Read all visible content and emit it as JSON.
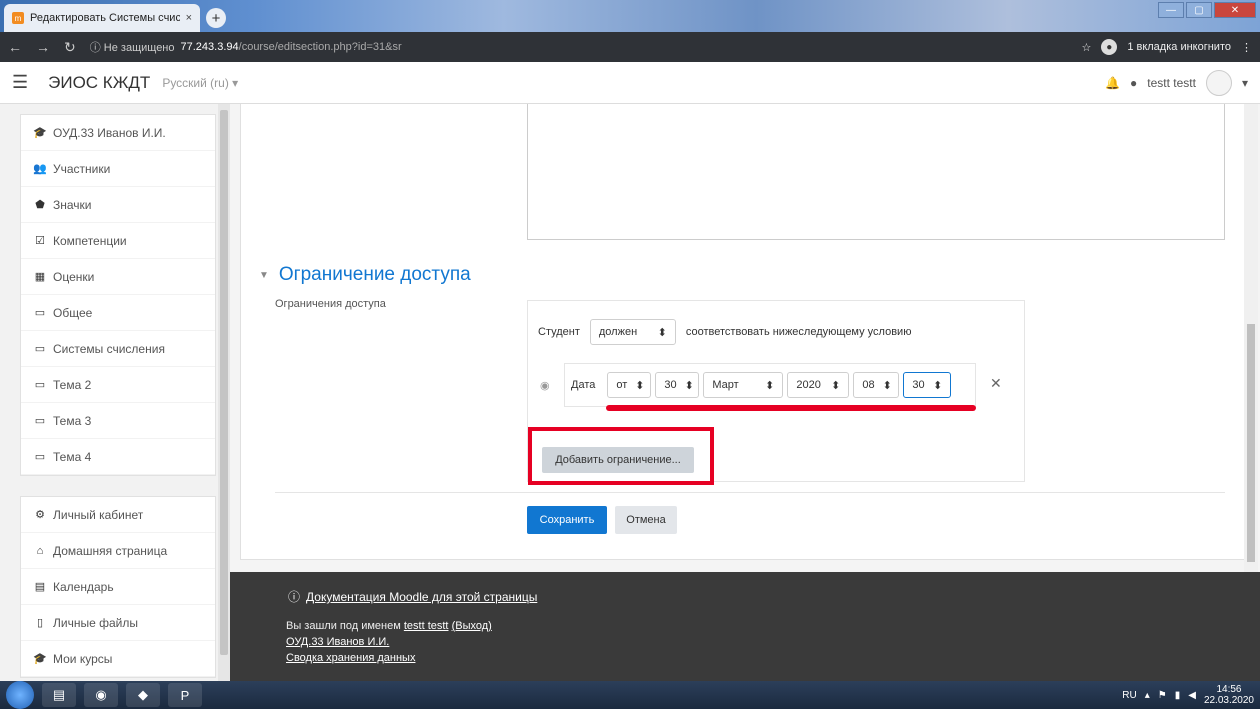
{
  "browser": {
    "tab_title": "Редактировать Системы счисле",
    "tab_close": "×",
    "new_tab": "+",
    "address_security": "ⓘ Не защищено",
    "address_host": "77.243.3.94",
    "address_path": "/course/editsection.php?id=31&sr",
    "incognito_label": "1 вкладка инкогнито",
    "win_min": "—",
    "win_max": "▢",
    "win_close": "✕"
  },
  "navbar": {
    "brand": "ЭИОС КЖДТ",
    "language": "Русский (ru) ▾",
    "user_name": "testt testt"
  },
  "sidebar": {
    "course_items": [
      {
        "label": "ОУД.33 Иванов И.И.",
        "icon": "graduation-cap-icon"
      },
      {
        "label": "Участники",
        "icon": "users-icon"
      },
      {
        "label": "Значки",
        "icon": "shield-icon"
      },
      {
        "label": "Компетенции",
        "icon": "check-square-icon"
      },
      {
        "label": "Оценки",
        "icon": "table-icon"
      },
      {
        "label": "Общее",
        "icon": "folder-icon"
      },
      {
        "label": "Системы счисления",
        "icon": "folder-icon"
      },
      {
        "label": "Тема 2",
        "icon": "folder-icon"
      },
      {
        "label": "Тема 3",
        "icon": "folder-icon"
      },
      {
        "label": "Тема 4",
        "icon": "folder-icon"
      }
    ],
    "site_items": [
      {
        "label": "Личный кабинет",
        "icon": "dashboard-icon"
      },
      {
        "label": "Домашняя страница",
        "icon": "home-icon"
      },
      {
        "label": "Календарь",
        "icon": "calendar-icon"
      },
      {
        "label": "Личные файлы",
        "icon": "file-icon"
      },
      {
        "label": "Мои курсы",
        "icon": "graduation-cap-icon"
      }
    ]
  },
  "form": {
    "section_title": "Ограничение доступа",
    "restrictions_label": "Ограничения доступа",
    "student_label": "Студент",
    "must_select": "должен",
    "match_text": "соответствовать нижеследующему условию",
    "date_label": "Дата",
    "date_from": "от",
    "date_day": "30",
    "date_month": "Март",
    "date_year": "2020",
    "date_hour": "08",
    "date_minute": "30",
    "add_restriction": "Добавить ограничение...",
    "save": "Сохранить",
    "cancel": "Отмена"
  },
  "footer": {
    "docs_link": "Документация Moodle для этой страницы",
    "logged_in_prefix": "Вы зашли под именем",
    "logged_in_user": "testt testt",
    "logout": "(Выход)",
    "course_link": "ОУД.33 Иванов И.И.",
    "data_retention": "Сводка хранения данных"
  },
  "taskbar": {
    "lang": "RU",
    "time": "14:56",
    "date": "22.03.2020"
  }
}
